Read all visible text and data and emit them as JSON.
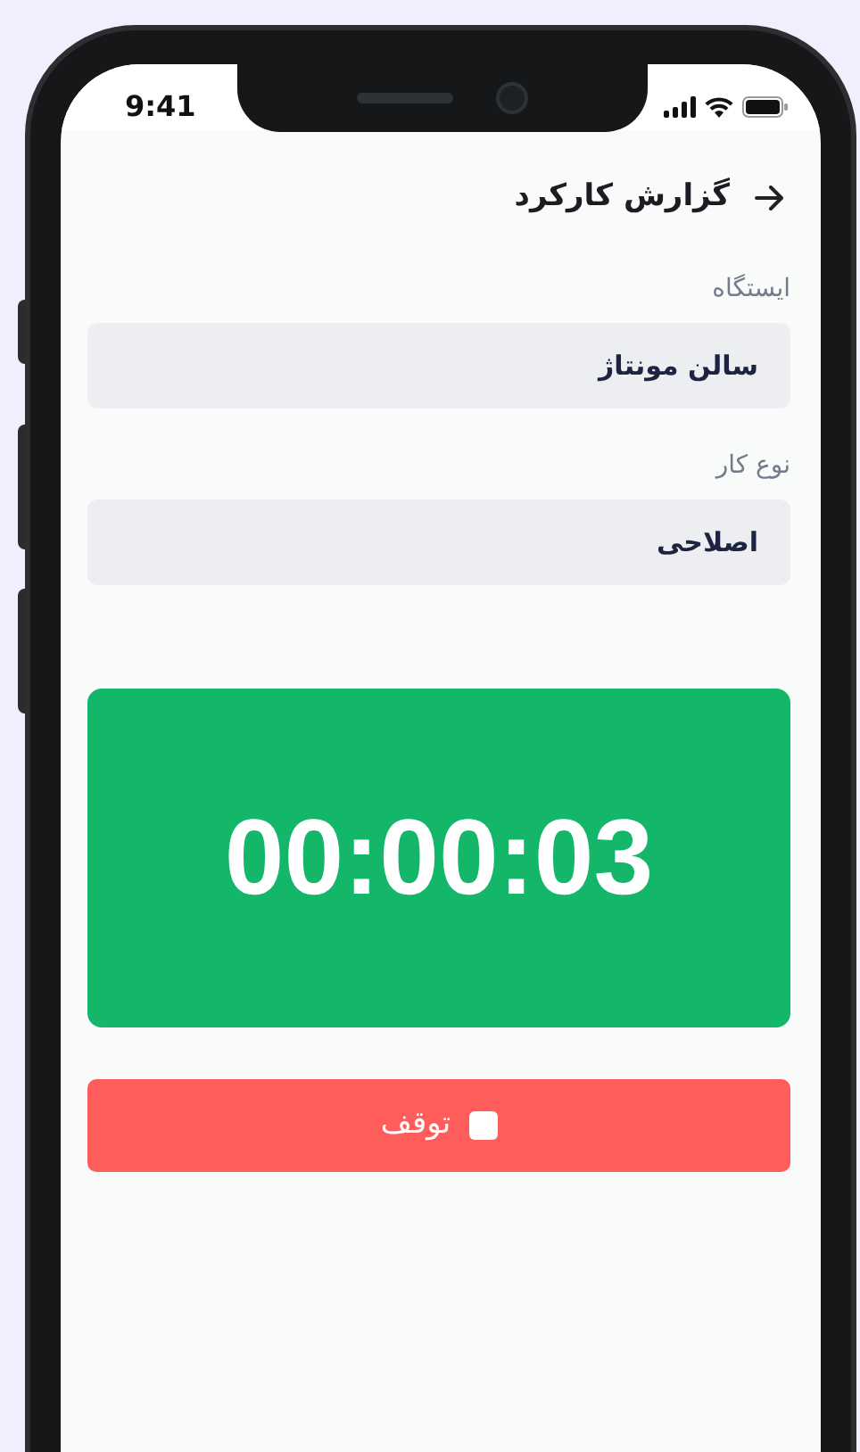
{
  "status_bar": {
    "time": "9:41"
  },
  "header": {
    "title": "گزارش کارکرد"
  },
  "fields": [
    {
      "label": "ایستگاه",
      "value": "سالن مونتاژ"
    },
    {
      "label": "نوع کار",
      "value": "اصلاحی"
    }
  ],
  "timer": {
    "reading": "00:00:03"
  },
  "stop_button": {
    "label": "توقف"
  }
}
